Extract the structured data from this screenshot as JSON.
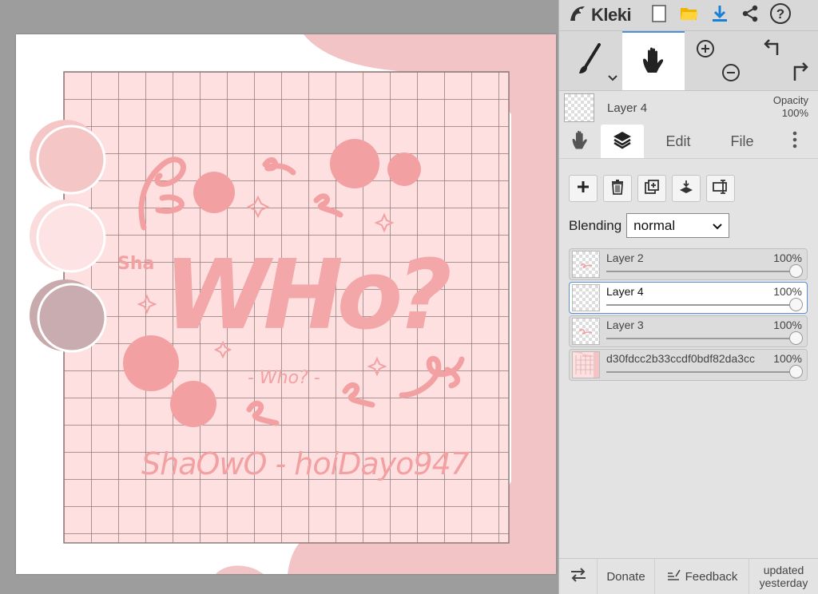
{
  "app": {
    "name": "Kleki"
  },
  "layer_info": {
    "name": "Layer 4",
    "opacity_label": "Opacity",
    "opacity_value": "100%"
  },
  "tabs": {
    "edit": "Edit",
    "file": "File"
  },
  "blending": {
    "label": "Blending",
    "value": "normal"
  },
  "layers": [
    {
      "name": "Layer 2",
      "opacity": "100%"
    },
    {
      "name": "Layer 4",
      "opacity": "100%"
    },
    {
      "name": "Layer 3",
      "opacity": "100%"
    },
    {
      "name": "d30fdcc2b33ccdf0bdf82da3cc",
      "opacity": "100%"
    }
  ],
  "bottom": {
    "donate": "Donate",
    "feedback": "Feedback",
    "updated_line1": "updated",
    "updated_line2": "yesterday"
  },
  "artwork": {
    "small_sha": "Sha",
    "main": "WHo?",
    "sub": "- Who? -",
    "signature": "ShaOwO - hoiDayo947"
  },
  "colors": {
    "panel_bg": "#e3e3e3",
    "accent": "#4a90d9",
    "art_pink": "#f4a3a6",
    "art_bg": "#fde0df",
    "grid": "#8f7a7a"
  },
  "icons": [
    "kleki-logo-icon",
    "new-image-icon",
    "open-folder-icon",
    "download-icon",
    "share-icon",
    "help-icon",
    "brush-icon",
    "hand-icon",
    "zoom-in-icon",
    "zoom-out-icon",
    "undo-icon",
    "redo-icon",
    "layers-icon",
    "more-icon",
    "add-layer-icon",
    "delete-layer-icon",
    "duplicate-layer-icon",
    "merge-down-icon",
    "rename-layer-icon",
    "swap-sides-icon",
    "feedback-icon"
  ]
}
